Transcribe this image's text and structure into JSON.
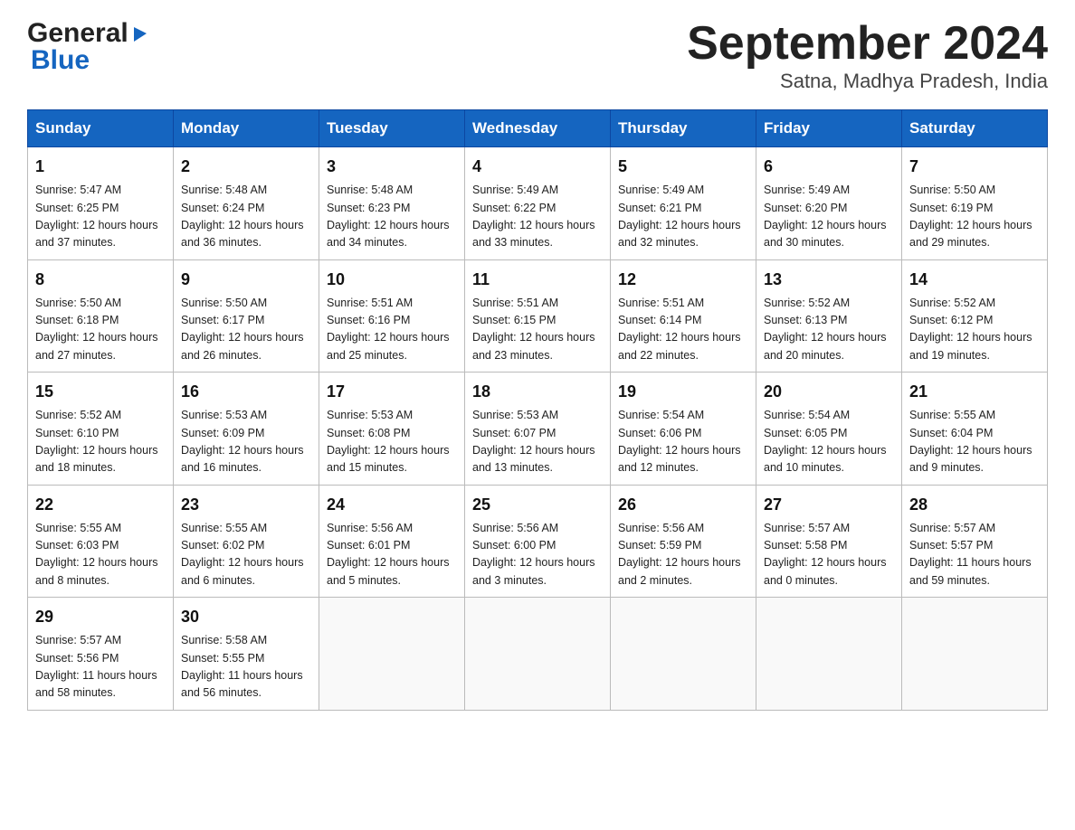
{
  "header": {
    "logo_general": "General",
    "logo_blue": "Blue",
    "title": "September 2024",
    "subtitle": "Satna, Madhya Pradesh, India"
  },
  "days_of_week": [
    "Sunday",
    "Monday",
    "Tuesday",
    "Wednesday",
    "Thursday",
    "Friday",
    "Saturday"
  ],
  "weeks": [
    [
      {
        "day": "1",
        "sunrise": "5:47 AM",
        "sunset": "6:25 PM",
        "daylight": "12 hours and 37 minutes."
      },
      {
        "day": "2",
        "sunrise": "5:48 AM",
        "sunset": "6:24 PM",
        "daylight": "12 hours and 36 minutes."
      },
      {
        "day": "3",
        "sunrise": "5:48 AM",
        "sunset": "6:23 PM",
        "daylight": "12 hours and 34 minutes."
      },
      {
        "day": "4",
        "sunrise": "5:49 AM",
        "sunset": "6:22 PM",
        "daylight": "12 hours and 33 minutes."
      },
      {
        "day": "5",
        "sunrise": "5:49 AM",
        "sunset": "6:21 PM",
        "daylight": "12 hours and 32 minutes."
      },
      {
        "day": "6",
        "sunrise": "5:49 AM",
        "sunset": "6:20 PM",
        "daylight": "12 hours and 30 minutes."
      },
      {
        "day": "7",
        "sunrise": "5:50 AM",
        "sunset": "6:19 PM",
        "daylight": "12 hours and 29 minutes."
      }
    ],
    [
      {
        "day": "8",
        "sunrise": "5:50 AM",
        "sunset": "6:18 PM",
        "daylight": "12 hours and 27 minutes."
      },
      {
        "day": "9",
        "sunrise": "5:50 AM",
        "sunset": "6:17 PM",
        "daylight": "12 hours and 26 minutes."
      },
      {
        "day": "10",
        "sunrise": "5:51 AM",
        "sunset": "6:16 PM",
        "daylight": "12 hours and 25 minutes."
      },
      {
        "day": "11",
        "sunrise": "5:51 AM",
        "sunset": "6:15 PM",
        "daylight": "12 hours and 23 minutes."
      },
      {
        "day": "12",
        "sunrise": "5:51 AM",
        "sunset": "6:14 PM",
        "daylight": "12 hours and 22 minutes."
      },
      {
        "day": "13",
        "sunrise": "5:52 AM",
        "sunset": "6:13 PM",
        "daylight": "12 hours and 20 minutes."
      },
      {
        "day": "14",
        "sunrise": "5:52 AM",
        "sunset": "6:12 PM",
        "daylight": "12 hours and 19 minutes."
      }
    ],
    [
      {
        "day": "15",
        "sunrise": "5:52 AM",
        "sunset": "6:10 PM",
        "daylight": "12 hours and 18 minutes."
      },
      {
        "day": "16",
        "sunrise": "5:53 AM",
        "sunset": "6:09 PM",
        "daylight": "12 hours and 16 minutes."
      },
      {
        "day": "17",
        "sunrise": "5:53 AM",
        "sunset": "6:08 PM",
        "daylight": "12 hours and 15 minutes."
      },
      {
        "day": "18",
        "sunrise": "5:53 AM",
        "sunset": "6:07 PM",
        "daylight": "12 hours and 13 minutes."
      },
      {
        "day": "19",
        "sunrise": "5:54 AM",
        "sunset": "6:06 PM",
        "daylight": "12 hours and 12 minutes."
      },
      {
        "day": "20",
        "sunrise": "5:54 AM",
        "sunset": "6:05 PM",
        "daylight": "12 hours and 10 minutes."
      },
      {
        "day": "21",
        "sunrise": "5:55 AM",
        "sunset": "6:04 PM",
        "daylight": "12 hours and 9 minutes."
      }
    ],
    [
      {
        "day": "22",
        "sunrise": "5:55 AM",
        "sunset": "6:03 PM",
        "daylight": "12 hours and 8 minutes."
      },
      {
        "day": "23",
        "sunrise": "5:55 AM",
        "sunset": "6:02 PM",
        "daylight": "12 hours and 6 minutes."
      },
      {
        "day": "24",
        "sunrise": "5:56 AM",
        "sunset": "6:01 PM",
        "daylight": "12 hours and 5 minutes."
      },
      {
        "day": "25",
        "sunrise": "5:56 AM",
        "sunset": "6:00 PM",
        "daylight": "12 hours and 3 minutes."
      },
      {
        "day": "26",
        "sunrise": "5:56 AM",
        "sunset": "5:59 PM",
        "daylight": "12 hours and 2 minutes."
      },
      {
        "day": "27",
        "sunrise": "5:57 AM",
        "sunset": "5:58 PM",
        "daylight": "12 hours and 0 minutes."
      },
      {
        "day": "28",
        "sunrise": "5:57 AM",
        "sunset": "5:57 PM",
        "daylight": "11 hours and 59 minutes."
      }
    ],
    [
      {
        "day": "29",
        "sunrise": "5:57 AM",
        "sunset": "5:56 PM",
        "daylight": "11 hours and 58 minutes."
      },
      {
        "day": "30",
        "sunrise": "5:58 AM",
        "sunset": "5:55 PM",
        "daylight": "11 hours and 56 minutes."
      },
      null,
      null,
      null,
      null,
      null
    ]
  ],
  "labels": {
    "sunrise": "Sunrise:",
    "sunset": "Sunset:",
    "daylight": "Daylight:"
  }
}
